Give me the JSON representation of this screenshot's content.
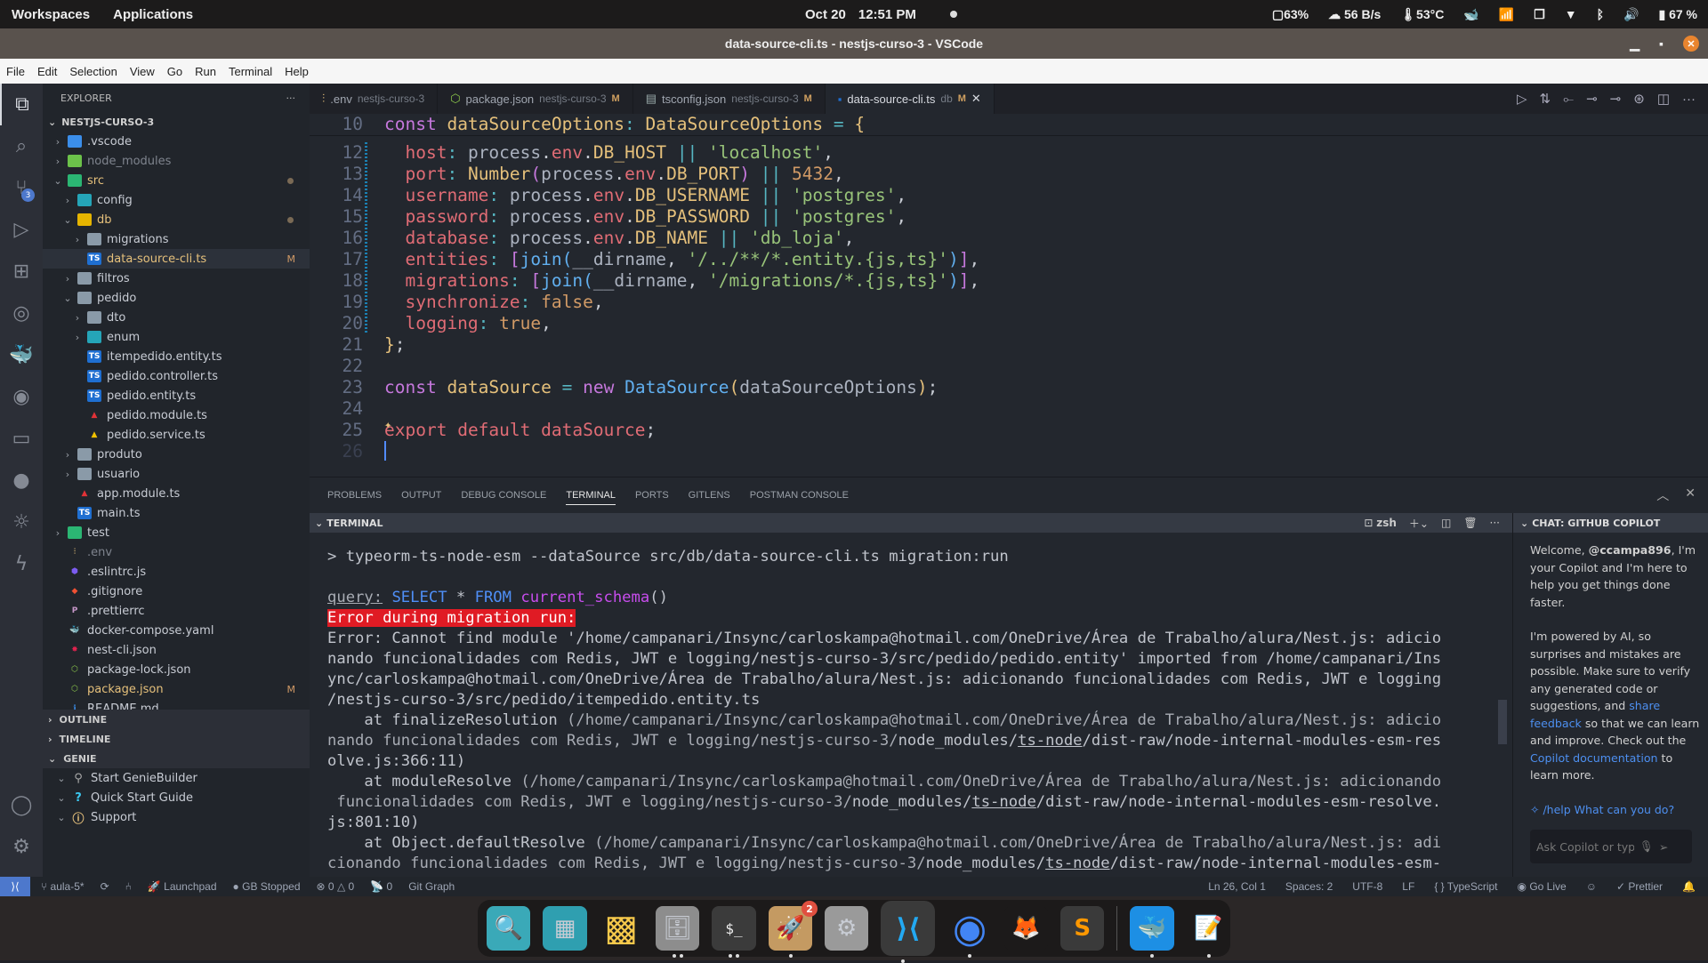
{
  "system_bar": {
    "workspaces": "Workspaces",
    "applications": "Applications",
    "date": "Oct 20",
    "time": "12:51 PM",
    "cpu": "63%",
    "net": "56 B/s",
    "temp": "53°C",
    "battery": "67 %"
  },
  "window": {
    "title": "data-source-cli.ts - nestjs-curso-3 - VSCode"
  },
  "menu": [
    "File",
    "Edit",
    "Selection",
    "View",
    "Go",
    "Run",
    "Terminal",
    "Help"
  ],
  "activity_bar": {
    "scm_badge": "3"
  },
  "explorer": {
    "header": "EXPLORER",
    "project": "NESTJS-CURSO-3",
    "items": [
      {
        "label": ".vscode",
        "depth": 1,
        "type": "folder",
        "expanded": false
      },
      {
        "label": "node_modules",
        "depth": 1,
        "type": "folder",
        "expanded": false,
        "dim": true
      },
      {
        "label": "src",
        "depth": 1,
        "type": "folder",
        "expanded": true,
        "status": "dot"
      },
      {
        "label": "config",
        "depth": 2,
        "type": "folder",
        "expanded": false
      },
      {
        "label": "db",
        "depth": 2,
        "type": "folder",
        "expanded": true,
        "status": "dot"
      },
      {
        "label": "migrations",
        "depth": 3,
        "type": "folder",
        "expanded": false
      },
      {
        "label": "data-source-cli.ts",
        "depth": 3,
        "type": "ts",
        "status": "M",
        "selected": true
      },
      {
        "label": "filtros",
        "depth": 2,
        "type": "folder",
        "expanded": false
      },
      {
        "label": "pedido",
        "depth": 2,
        "type": "folder",
        "expanded": true
      },
      {
        "label": "dto",
        "depth": 3,
        "type": "folder",
        "expanded": false
      },
      {
        "label": "enum",
        "depth": 3,
        "type": "folder",
        "expanded": false
      },
      {
        "label": "itempedido.entity.ts",
        "depth": 3,
        "type": "ts"
      },
      {
        "label": "pedido.controller.ts",
        "depth": 3,
        "type": "ts"
      },
      {
        "label": "pedido.entity.ts",
        "depth": 3,
        "type": "ts"
      },
      {
        "label": "pedido.module.ts",
        "depth": 3,
        "type": "angular-red"
      },
      {
        "label": "pedido.service.ts",
        "depth": 3,
        "type": "angular-yellow"
      },
      {
        "label": "produto",
        "depth": 2,
        "type": "folder",
        "expanded": false
      },
      {
        "label": "usuario",
        "depth": 2,
        "type": "folder",
        "expanded": false
      },
      {
        "label": "app.module.ts",
        "depth": 2,
        "type": "angular-red"
      },
      {
        "label": "main.ts",
        "depth": 2,
        "type": "ts"
      },
      {
        "label": "test",
        "depth": 1,
        "type": "folder",
        "expanded": false
      },
      {
        "label": ".env",
        "depth": 1,
        "type": "env",
        "dim": true
      },
      {
        "label": ".eslintrc.js",
        "depth": 1,
        "type": "eslint"
      },
      {
        "label": ".gitignore",
        "depth": 1,
        "type": "git"
      },
      {
        "label": ".prettierrc",
        "depth": 1,
        "type": "prettier"
      },
      {
        "label": "docker-compose.yaml",
        "depth": 1,
        "type": "docker"
      },
      {
        "label": "nest-cli.json",
        "depth": 1,
        "type": "nest"
      },
      {
        "label": "package-lock.json",
        "depth": 1,
        "type": "node"
      },
      {
        "label": "package.json",
        "depth": 1,
        "type": "node",
        "status": "M"
      },
      {
        "label": "README.md",
        "depth": 1,
        "type": "info"
      }
    ],
    "sections": [
      "OUTLINE",
      "TIMELINE",
      "GENIE"
    ],
    "genie_items": [
      "Start GenieBuilder",
      "Quick Start Guide",
      "Support"
    ]
  },
  "tabs": [
    {
      "label": ".env",
      "desc": "nestjs-curso-3",
      "mod": "",
      "icon": "env"
    },
    {
      "label": "package.json",
      "desc": "nestjs-curso-3",
      "mod": "M",
      "icon": "node"
    },
    {
      "label": "tsconfig.json",
      "desc": "nestjs-curso-3",
      "mod": "M",
      "icon": "tsconfig"
    },
    {
      "label": "data-source-cli.ts",
      "desc": "db",
      "mod": "M",
      "icon": "ts",
      "active": true
    }
  ],
  "editor": {
    "lines": [
      {
        "n": "10",
        "html": "<span class='kw'>const</span> <span class='vr'>dataSourceOptions</span><span class='op'>:</span> <span class='ty'>DataSourceOptions</span> <span class='op'>=</span> <span class='br1'>{</span>"
      },
      {
        "n": "12",
        "html": "  <span class='pr'>host</span><span class='op'>:</span> <span class='pl'>process</span>.<span class='pr'>env</span>.<span class='vr'>DB_HOST</span> <span class='op'>||</span> <span class='st'>'localhost'</span>,"
      },
      {
        "n": "13",
        "html": "  <span class='pr'>port</span><span class='op'>:</span> <span class='ty'>Number</span><span class='br2'>(</span><span class='pl'>process</span>.<span class='pr'>env</span>.<span class='vr'>DB_PORT</span><span class='br2'>)</span> <span class='op'>||</span> <span class='nm'>5432</span>,"
      },
      {
        "n": "14",
        "html": "  <span class='pr'>username</span><span class='op'>:</span> <span class='pl'>process</span>.<span class='pr'>env</span>.<span class='vr'>DB_USERNAME</span> <span class='op'>||</span> <span class='st'>'postgres'</span>,"
      },
      {
        "n": "15",
        "html": "  <span class='pr'>password</span><span class='op'>:</span> <span class='pl'>process</span>.<span class='pr'>env</span>.<span class='vr'>DB_PASSWORD</span> <span class='op'>||</span> <span class='st'>'postgres'</span>,"
      },
      {
        "n": "16",
        "html": "  <span class='pr'>database</span><span class='op'>:</span> <span class='pl'>process</span>.<span class='pr'>env</span>.<span class='vr'>DB_NAME</span> <span class='op'>||</span> <span class='st'>'db_loja'</span>,"
      },
      {
        "n": "17",
        "html": "  <span class='pr'>entities</span><span class='op'>:</span> <span class='br2'>[</span><span class='fn'>join</span><span class='br3'>(</span><span class='pl'>__dirname</span>, <span class='st'>'/../**/*.entity.{js,ts}'</span><span class='br3'>)</span><span class='br2'>]</span>,"
      },
      {
        "n": "18",
        "html": "  <span class='pr'>migrations</span><span class='op'>:</span> <span class='br2'>[</span><span class='fn'>join</span><span class='br3'>(</span><span class='pl'>__dirname</span>, <span class='st'>'/migrations/*.{js,ts}'</span><span class='br3'>)</span><span class='br2'>]</span>,"
      },
      {
        "n": "19",
        "html": "  <span class='pr'>synchronize</span><span class='op'>:</span> <span class='nm'>false</span>,"
      },
      {
        "n": "20",
        "html": "  <span class='pr'>logging</span><span class='op'>:</span> <span class='nm'>true</span>,"
      },
      {
        "n": "21",
        "html": "<span class='br1'>}</span>;"
      },
      {
        "n": "22",
        "html": ""
      },
      {
        "n": "23",
        "html": "<span class='kw'>const</span> <span class='vr'>dataSource</span> <span class='op'>=</span> <span class='kw'>new</span> <span class='fn'>DataSource</span><span class='br1'>(</span><span class='pl'>dataSourceOptions</span><span class='br1'>)</span>;"
      },
      {
        "n": "24",
        "html": ""
      },
      {
        "n": "25",
        "html": "<span class='ex'>export</span> <span class='ex'>default</span> <span class='ex'>dataSource</span>;"
      },
      {
        "n": "26",
        "html": ""
      }
    ]
  },
  "panel": {
    "tabs": [
      "PROBLEMS",
      "OUTPUT",
      "DEBUG CONSOLE",
      "TERMINAL",
      "PORTS",
      "GITLENS",
      "POSTMAN CONSOLE"
    ],
    "active_tab": "TERMINAL",
    "terminal_header": "TERMINAL",
    "shell": "zsh",
    "terminal_lines": [
      {
        "text": "> typeorm-ts-node-esm --dataSource src/db/data-source-cli.ts migration:run"
      },
      {
        "text": ""
      },
      {
        "html": "<span class='u grey'>query:</span> <span class='bl'>SELECT</span> * <span class='bl'>FROM</span> <span class='mg'>current_schema</span>()"
      },
      {
        "html": "<span class='err'>Error during migration run:</span>"
      },
      {
        "text": "Error: Cannot find module '/home/campanari/Insync/carloskampa@hotmail.com/OneDrive/Área de Trabalho/alura/Nest.js: adicio"
      },
      {
        "text": "nando funcionalidades com Redis, JWT e logging/nestjs-curso-3/src/pedido/pedido.entity' imported from /home/campanari/Ins"
      },
      {
        "text": "ync/carloskampa@hotmail.com/OneDrive/Área de Trabalho/alura/Nest.js: adicionando funcionalidades com Redis, JWT e logging"
      },
      {
        "text": "/nestjs-curso-3/src/pedido/itempedido.entity.ts"
      },
      {
        "html": "    at finalizeResolution <span class='grey'>(/home/campanari/Insync/carloskampa@hotmail.com/OneDrive/Área de Trabalho/alura/Nest.js: adicio</span>"
      },
      {
        "html": "<span class='grey'>nando funcionalidades com Redis, JWT e logging/nestjs-curso-3/</span>node_modules/<span class='u'>ts-node</span>/dist-raw/node-internal-modules-esm-res"
      },
      {
        "text": "olve.js:366:11)"
      },
      {
        "html": "    at moduleResolve <span class='grey'>(/home/campanari/Insync/carloskampa@hotmail.com/OneDrive/Área de Trabalho/alura/Nest.js: adicionando</span>"
      },
      {
        "html": "<span class='grey'> funcionalidades com Redis, JWT e logging/nestjs-curso-3/</span>node_modules/<span class='u'>ts-node</span>/dist-raw/node-internal-modules-esm-resolve."
      },
      {
        "text": "js:801:10)"
      },
      {
        "html": "    at Object.defaultResolve <span class='grey'>(/home/campanari/Insync/carloskampa@hotmail.com/OneDrive/Área de Trabalho/alura/Nest.js: adi</span>"
      },
      {
        "html": "<span class='grey'>cionando funcionalidades com Redis, JWT e logging/nestjs-curso-3/</span>node_modules/<span class='u'>ts-node</span>/dist-raw/node-internal-modules-esm-"
      }
    ]
  },
  "chat": {
    "header": "CHAT: GITHUB COPILOT",
    "welcome_pre": "Welcome, ",
    "user": "@ccampa896",
    "welcome_post": ", I'm your Copilot and I'm here to help you get things done faster.",
    "p2_a": "I'm powered by AI, so surprises and mistakes are possible. Make sure to verify any generated code or suggestions, and ",
    "link_feedback": "share feedback",
    "p2_b": " so that we can learn and improve. Check out the ",
    "link_docs": "Copilot documentation",
    "p2_c": " to learn more.",
    "help": "/help What can you do?",
    "input_placeholder": "Ask Copilot or type"
  },
  "status_bar": {
    "branch": "aula-5*",
    "launchpad": "Launchpad",
    "gb": "GB Stopped",
    "errors": "0",
    "warnings": "0",
    "ports": "0",
    "git_graph": "Git Graph",
    "position": "Ln 26, Col 1",
    "spaces": "Spaces: 2",
    "encoding": "UTF-8",
    "eol": "LF",
    "language": "TypeScript",
    "golive": "Go Live",
    "prettier": "Prettier"
  },
  "dock": {
    "apps": [
      {
        "name": "search-app",
        "glyph": "🔍",
        "bg": "#3aa9b8"
      },
      {
        "name": "workspace-app",
        "glyph": "▦",
        "bg": "#2f9fb0"
      },
      {
        "name": "app-grid",
        "glyph": "▩",
        "bg": "#1c1a1a"
      },
      {
        "name": "files-app",
        "glyph": "🗄",
        "bg": "#8d8d8d",
        "dots": 2
      },
      {
        "name": "terminal-app",
        "glyph": "$_",
        "bg": "#3b3b3b",
        "dots": 2
      },
      {
        "name": "installer-app",
        "glyph": "🚀",
        "bg": "#c49a62",
        "dots": 1,
        "badge": "2"
      },
      {
        "name": "settings-app",
        "glyph": "⚙",
        "bg": "#9a9a9a"
      },
      {
        "name": "vscode-app",
        "glyph": "⟩⟨",
        "bg": "#1c1a1a",
        "dots": 1,
        "active": true
      },
      {
        "name": "chrome-app",
        "glyph": "◉",
        "bg": "#1c1a1a",
        "dots": 1
      },
      {
        "name": "firefox-app",
        "glyph": "🦊",
        "bg": "#1c1a1a"
      },
      {
        "name": "sublime-app",
        "glyph": "S",
        "bg": "#3a3a3a"
      },
      {
        "name": "docker-app",
        "glyph": "🐳",
        "bg": "#1d8fe4",
        "dots": 1
      },
      {
        "name": "editor-app",
        "glyph": "📝",
        "bg": "#1c1a1a",
        "dots": 1
      }
    ]
  }
}
